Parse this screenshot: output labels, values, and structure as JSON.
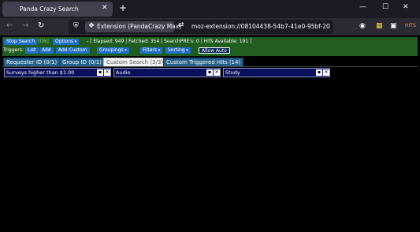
{
  "browser": {
    "tab_title": "Panda Crazy Search",
    "tab_close_glyph": "✕",
    "new_tab_glyph": "+",
    "window_controls": {
      "minimize": "—",
      "maximize": "☐",
      "close": "✕"
    },
    "identity_label": "Extension (PandaCrazy Max)",
    "url": "moz-extension://08104438-54b7-41e0-95bf-20",
    "toolbar_icons": [
      "pocket-icon",
      "extension-icon",
      "screenshot-icon",
      "hits-icon"
    ]
  },
  "controls": {
    "stop_search_label": "Stop Search",
    "on_status": "[ON]",
    "options_label": "Options",
    "stats_text": "- [ Elapsed: 949 | Fetched: 354 | SearchPRE's: 0 | HITs Available: 191 ]",
    "triggers_label": "Triggers:",
    "list_label": "List",
    "add_label": "Add",
    "add_custom_label": "Add Custom",
    "groupings_label": "Groupings",
    "filters_label": "Filters",
    "sorting_label": "Sorting",
    "allow_auto_label": "Allow Auto"
  },
  "tabs": [
    {
      "label": "Requester ID (0/1)",
      "active": false
    },
    {
      "label": "Group ID (0/1)",
      "active": false
    },
    {
      "label": "Custom Search (3/3)",
      "active": true
    },
    {
      "label": "Custom Triggered Hits (14)",
      "active": false
    }
  ],
  "panels": [
    {
      "title": "Surveys higher than $1.00"
    },
    {
      "title": "Audio"
    },
    {
      "title": "Study"
    }
  ],
  "panel_buttons": {
    "collapse": "▪",
    "close": "✕"
  },
  "colors": {
    "control_bar": "#205d1f",
    "button": "#1f6fc8",
    "panel": "#09105c",
    "active_tab": "#f2f2f2"
  }
}
